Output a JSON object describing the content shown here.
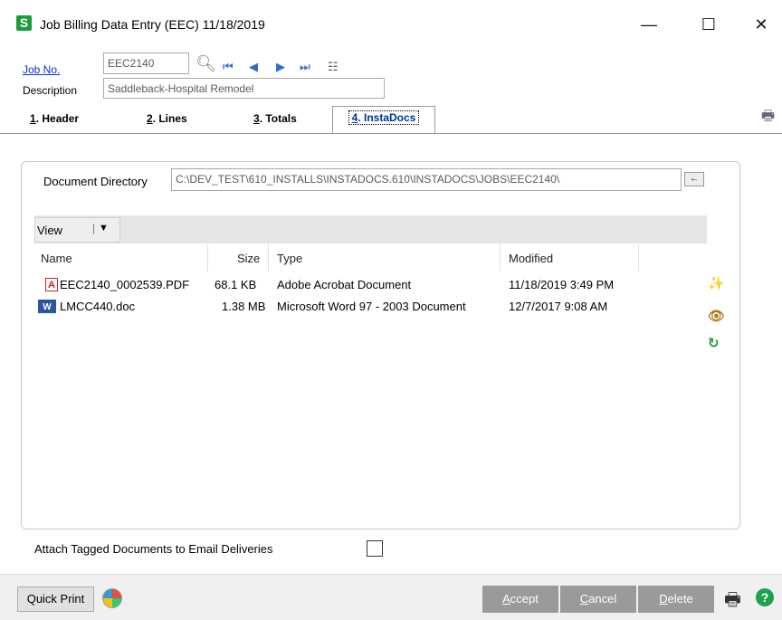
{
  "window": {
    "app_icon": "S",
    "title": "Job Billing Data Entry (EEC) 11/18/2019",
    "minimize": "—",
    "maximize": "☐",
    "close": "✕"
  },
  "header": {
    "job_no_label": "Job No.",
    "job_no_value": "EEC2140",
    "description_label": "Description",
    "description_value": "Saddleback-Hospital Remodel",
    "nav_icons": [
      "search-icon",
      "first-record-icon",
      "previous-record-icon",
      "next-record-icon",
      "last-record-icon",
      "list-icon"
    ]
  },
  "tabs": [
    {
      "key": "1",
      "label": ". Header"
    },
    {
      "key": "2",
      "label": ". Lines"
    },
    {
      "key": "3",
      "label": ". Totals"
    },
    {
      "key": "4",
      "label": ". InstaDocs",
      "active": true
    }
  ],
  "instadocs": {
    "doc_dir_label": "Document Directory",
    "doc_dir_value": "C:\\DEV_TEST\\610_INSTALLS\\INSTADOCS.610\\INSTADOCS\\JOBS\\EEC2140\\",
    "view_label": "View",
    "columns": {
      "name": "Name",
      "size": "Size",
      "type": "Type",
      "modified": "Modified"
    },
    "files": [
      {
        "icon": "pdf-file-icon",
        "name": "EEC2140_0002539.PDF",
        "size": "68.1 KB",
        "type": "Adobe Acrobat Document",
        "modified": "11/18/2019 3:49 PM"
      },
      {
        "icon": "word-file-icon",
        "name": "LMCC440.doc",
        "size": "1.38 MB",
        "type": "Microsoft Word 97 - 2003 Document",
        "modified": "12/7/2017 9:08 AM"
      }
    ],
    "attach_label": "Attach Tagged Documents to Email Deliveries"
  },
  "footer": {
    "quick_print": "Quick Print",
    "accept_key": "A",
    "accept_rest": "ccept",
    "cancel_key": "C",
    "cancel_rest": "ancel",
    "delete_key": "D",
    "delete_rest": "elete"
  }
}
